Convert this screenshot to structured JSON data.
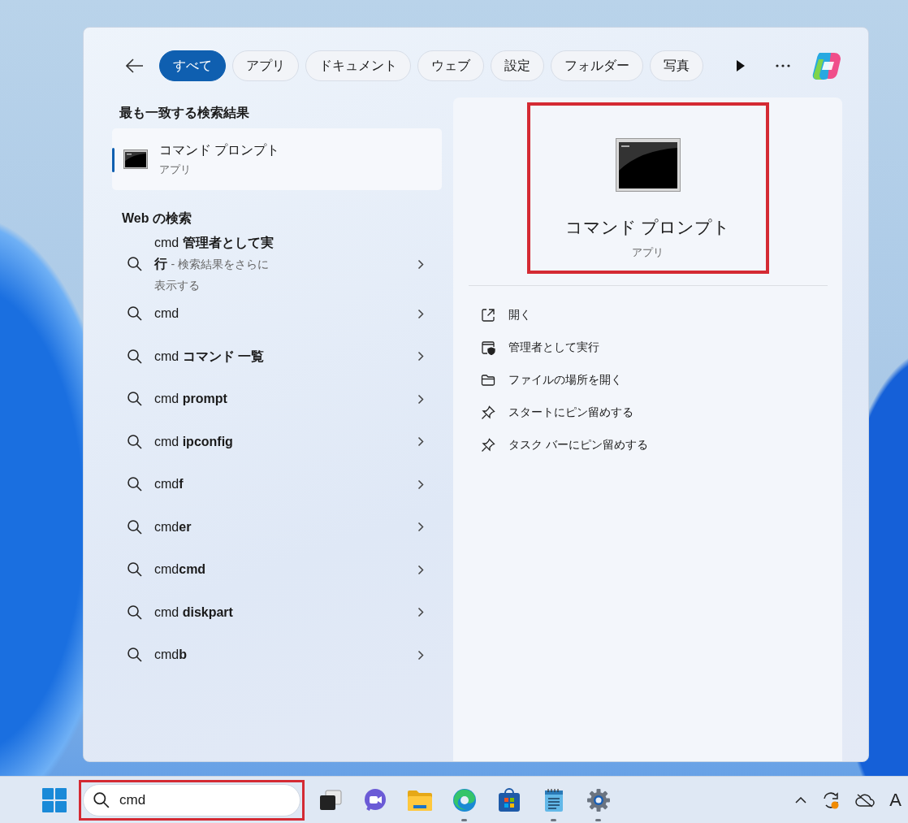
{
  "search_panel": {
    "tabs": [
      {
        "label": "すべて",
        "selected": true
      },
      {
        "label": "アプリ",
        "selected": false
      },
      {
        "label": "ドキュメント",
        "selected": false
      },
      {
        "label": "ウェブ",
        "selected": false
      },
      {
        "label": "設定",
        "selected": false
      },
      {
        "label": "フォルダー",
        "selected": false
      },
      {
        "label": "写真",
        "selected": false
      }
    ],
    "best_match": {
      "heading": "最も一致する検索結果",
      "item": {
        "title": "コマンド プロンプト",
        "subtitle": "アプリ",
        "selected": true
      }
    },
    "web_search": {
      "heading": "Web の検索",
      "results": [
        {
          "text": "cmd **管理者として実行**",
          "hint": "- 検索結果をさらに表示する"
        },
        {
          "text": "cmd"
        },
        {
          "text": "cmd **コマンド 一覧**"
        },
        {
          "text": "cmd **prompt**"
        },
        {
          "text": "cmd **ipconfig**"
        },
        {
          "text": "cmd**f**"
        },
        {
          "text": "cmd**er**"
        },
        {
          "text": "cmd**cmd**"
        },
        {
          "text": "cmd **diskpart**"
        },
        {
          "text": "cmd**b**"
        }
      ]
    },
    "details": {
      "title": "コマンド プロンプト",
      "subtitle": "アプリ",
      "highlighted": true,
      "actions": [
        {
          "kind": "open",
          "label": "開く"
        },
        {
          "kind": "admin",
          "label": "管理者として実行"
        },
        {
          "kind": "folder",
          "label": "ファイルの場所を開く"
        },
        {
          "kind": "pin",
          "label": "スタートにピン留めする"
        },
        {
          "kind": "pin",
          "label": "タスク バーにピン留めする"
        }
      ]
    }
  },
  "taskbar": {
    "search": {
      "value": "cmd",
      "highlighted": true
    },
    "apps": [
      {
        "kind": "task-view",
        "running": false
      },
      {
        "kind": "chat",
        "running": false
      },
      {
        "kind": "explorer",
        "running": false
      },
      {
        "kind": "edge",
        "running": true
      },
      {
        "kind": "store",
        "running": false
      },
      {
        "kind": "notepad",
        "running": true
      },
      {
        "kind": "settings",
        "running": true
      }
    ],
    "tray": {
      "ime": "A"
    }
  }
}
